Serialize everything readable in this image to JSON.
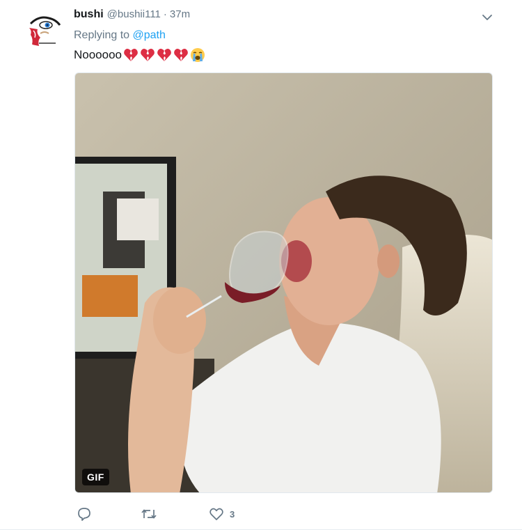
{
  "tweet": {
    "display_name": "bushi",
    "handle": "@bushii111",
    "separator": "·",
    "timestamp": "37m",
    "replying_prefix": "Replying to",
    "replying_to": "@path",
    "text": "Noooooo",
    "text_emojis": [
      "broken-heart",
      "broken-heart",
      "broken-heart",
      "broken-heart",
      "loudly-crying-face"
    ],
    "media": {
      "type": "gif",
      "badge": "GIF"
    },
    "actions": {
      "reply_count": "",
      "retweet_count": "",
      "like_count": "3"
    }
  },
  "colors": {
    "link": "#1da1f2",
    "muted": "#657786",
    "text": "#14171a"
  }
}
